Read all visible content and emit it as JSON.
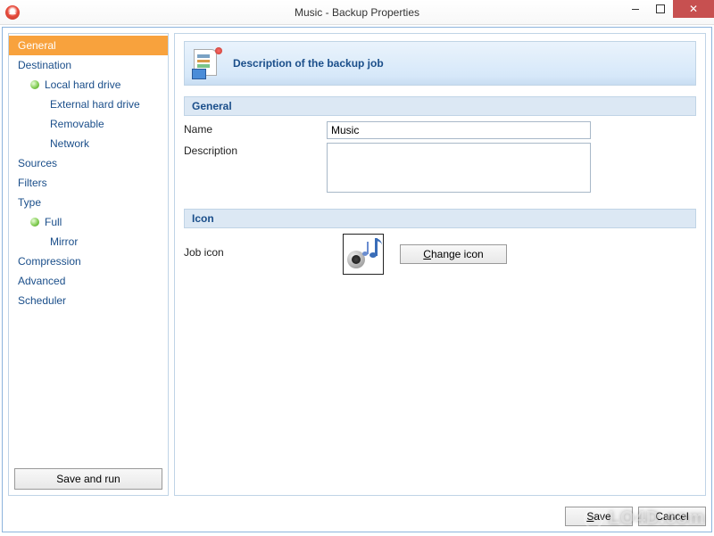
{
  "window": {
    "title": "Music - Backup Properties"
  },
  "sidebar": {
    "items": [
      {
        "label": "General",
        "active": true,
        "indent": false,
        "bullet": false
      },
      {
        "label": "Destination",
        "active": false,
        "indent": false,
        "bullet": false
      },
      {
        "label": "Local hard drive",
        "active": false,
        "indent": true,
        "bullet": true
      },
      {
        "label": "External hard drive",
        "active": false,
        "indent": true,
        "bullet": false
      },
      {
        "label": "Removable",
        "active": false,
        "indent": true,
        "bullet": false
      },
      {
        "label": "Network",
        "active": false,
        "indent": true,
        "bullet": false
      },
      {
        "label": "Sources",
        "active": false,
        "indent": false,
        "bullet": false
      },
      {
        "label": "Filters",
        "active": false,
        "indent": false,
        "bullet": false
      },
      {
        "label": "Type",
        "active": false,
        "indent": false,
        "bullet": false
      },
      {
        "label": "Full",
        "active": false,
        "indent": true,
        "bullet": true
      },
      {
        "label": "Mirror",
        "active": false,
        "indent": true,
        "bullet": false
      },
      {
        "label": "Compression",
        "active": false,
        "indent": false,
        "bullet": false
      },
      {
        "label": "Advanced",
        "active": false,
        "indent": false,
        "bullet": false
      },
      {
        "label": "Scheduler",
        "active": false,
        "indent": false,
        "bullet": false
      }
    ],
    "save_and_run": "Save and run"
  },
  "main": {
    "header": "Description of the backup job",
    "sections": {
      "general": {
        "title": "General",
        "name_label": "Name",
        "name_value": "Music",
        "description_label": "Description",
        "description_value": ""
      },
      "icon": {
        "title": "Icon",
        "job_icon_label": "Job icon",
        "change_icon_label": "Change icon"
      }
    }
  },
  "footer": {
    "save": "Save",
    "cancel": "Cancel"
  },
  "watermark": "LO4D.com"
}
